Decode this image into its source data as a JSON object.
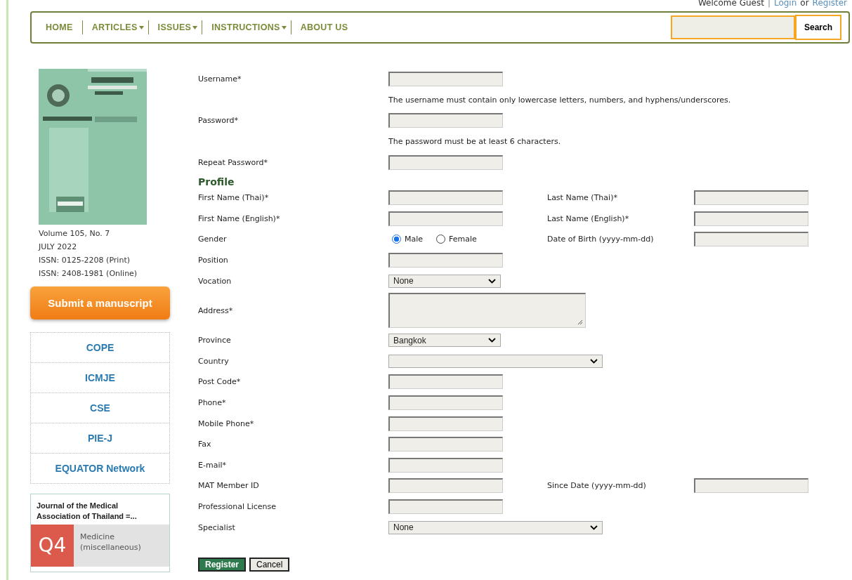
{
  "top_bar": {
    "greeting": "Welcome Guest",
    "separator": "|",
    "login": "Login",
    "or": "or",
    "register": "Register"
  },
  "nav": {
    "items": [
      {
        "label": "HOME",
        "dropdown": false
      },
      {
        "label": "ARTICLES",
        "dropdown": true
      },
      {
        "label": "ISSUES",
        "dropdown": true
      },
      {
        "label": "INSTRUCTIONS",
        "dropdown": true
      },
      {
        "label": "ABOUT US",
        "dropdown": false
      }
    ],
    "search_button": "Search"
  },
  "sidebar": {
    "issue_lines": [
      "Volume 105, No. 7",
      "JULY 2022",
      "ISSN: 0125-2208 (Print)",
      "ISSN: 2408-1981 (Online)"
    ],
    "submit_button": "Submit a manuscript",
    "links": [
      "COPE",
      "ICMJE",
      "CSE",
      "PIE-J",
      "EQUATOR Network"
    ],
    "ranking": {
      "title": "Journal of the Medical Association of Thailand =...",
      "quartile": "Q4",
      "category": "Medicine (miscellaneous)"
    }
  },
  "form": {
    "rows": [
      {
        "kind": "text",
        "label": "Username*"
      },
      {
        "kind": "hint",
        "text": "The username must contain only lowercase letters, numbers, and hyphens/underscores."
      },
      {
        "kind": "text",
        "label": "Password*"
      },
      {
        "kind": "hint",
        "text": "The password must be at least 6 characters."
      },
      {
        "kind": "text",
        "label": "Repeat Password*"
      },
      {
        "kind": "heading",
        "text": "Profile"
      },
      {
        "kind": "text",
        "label": "First Name (Thai)*",
        "extra": "Last Name (Thai)*"
      },
      {
        "kind": "text",
        "label": "First Name (English)*",
        "extra": "Last Name (English)*"
      },
      {
        "kind": "radio",
        "label": "Gender",
        "options": [
          {
            "label": "Male",
            "selected": true
          },
          {
            "label": "Female",
            "selected": false
          }
        ],
        "extra": "Date of Birth (yyyy-mm-dd)"
      },
      {
        "kind": "text",
        "label": "Position"
      },
      {
        "kind": "select",
        "label": "Vocation",
        "value": "None"
      },
      {
        "kind": "textarea",
        "label": "Address*"
      },
      {
        "kind": "select",
        "label": "Province",
        "value": "Bangkok"
      },
      {
        "kind": "wide-select",
        "label": "Country"
      },
      {
        "kind": "text",
        "label": "Post Code*"
      },
      {
        "kind": "text",
        "label": "Phone*"
      },
      {
        "kind": "text",
        "label": "Mobile Phone*"
      },
      {
        "kind": "text",
        "label": "Fax"
      },
      {
        "kind": "text",
        "label": "E-mail*"
      },
      {
        "kind": "text",
        "label": "MAT Member ID",
        "extra": "Since Date (yyyy-mm-dd)"
      },
      {
        "kind": "text",
        "label": "Professional License"
      },
      {
        "kind": "wide-select",
        "label": "Specialist",
        "value": "None"
      }
    ],
    "buttons": [
      {
        "label": "Register",
        "kind": "primary"
      },
      {
        "label": "Cancel",
        "kind": "secondary"
      }
    ]
  }
}
